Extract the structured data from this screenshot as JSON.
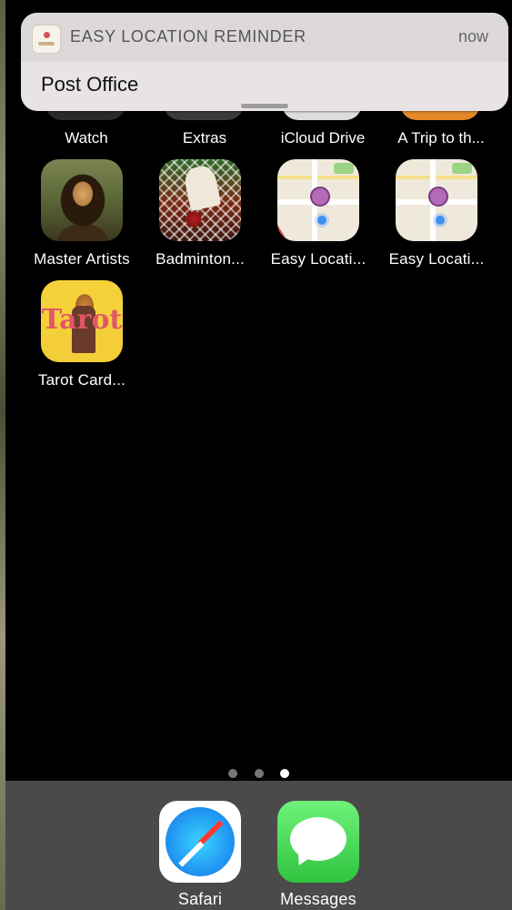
{
  "notification": {
    "app_name": "EASY LOCATION REMINDER",
    "time": "now",
    "message": "Post Office"
  },
  "home": {
    "top_row_labels": [
      "Watch",
      "Extras",
      "iCloud Drive",
      "A Trip to th..."
    ],
    "apps": [
      {
        "label": "Master Artists",
        "icon": "mona-lisa-icon"
      },
      {
        "label": "Badminton...",
        "icon": "shuttlecock-icon"
      },
      {
        "label": "Easy Locati...",
        "icon": "map-icon"
      },
      {
        "label": "Easy Locati...",
        "icon": "map-icon"
      },
      {
        "label": "Tarot Card...",
        "icon": "tarot-card-icon",
        "icon_text": "Tarot"
      }
    ],
    "page_indicator": {
      "pages": 3,
      "current": 3
    }
  },
  "dock": {
    "apps": [
      {
        "label": "Safari",
        "icon": "safari-compass-icon"
      },
      {
        "label": "Messages",
        "icon": "speech-bubble-icon"
      }
    ]
  }
}
